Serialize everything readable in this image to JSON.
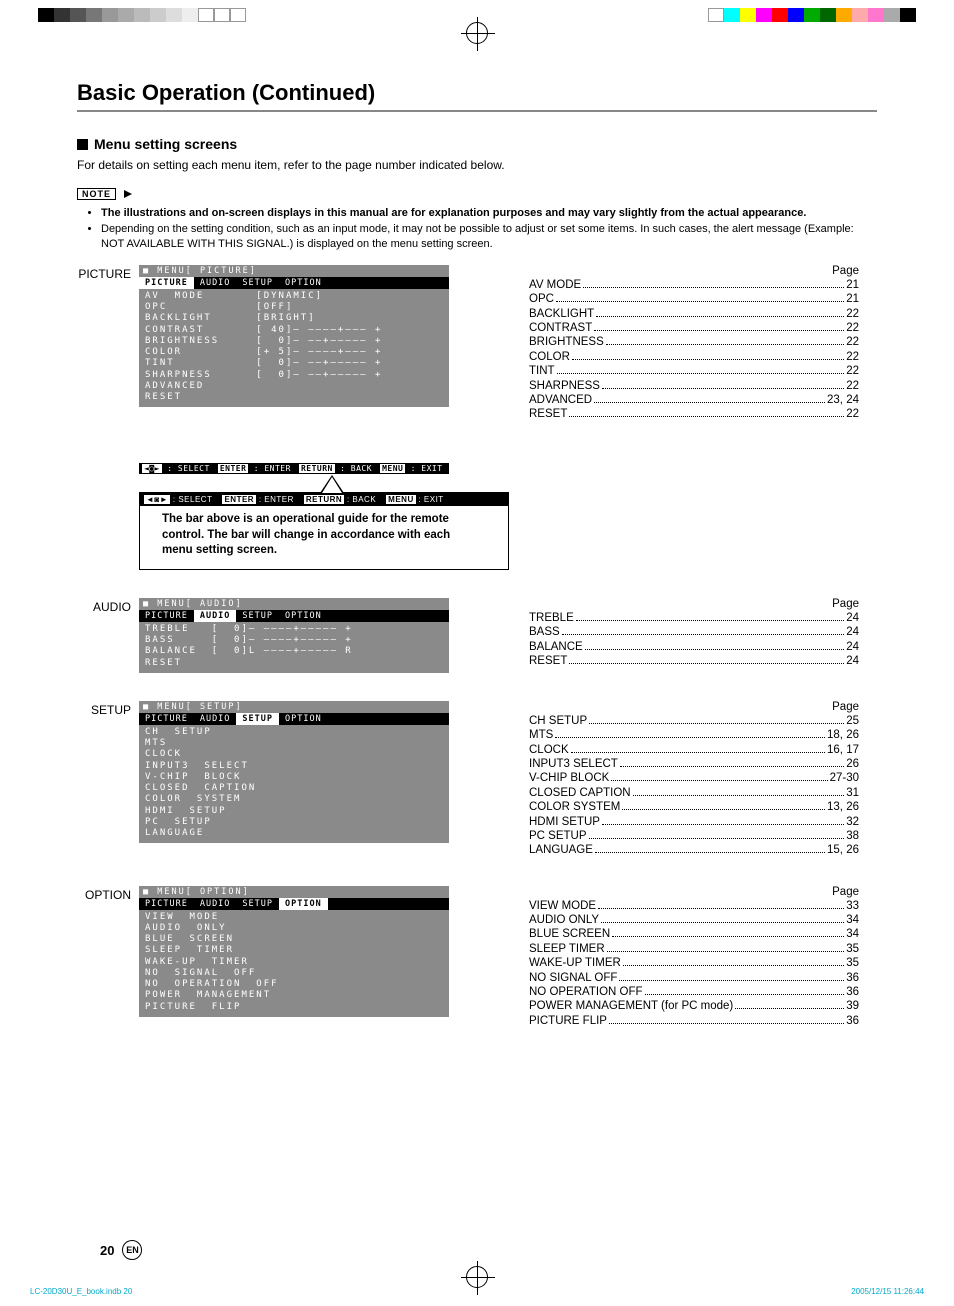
{
  "header": {
    "title": "Basic Operation (Continued)"
  },
  "subhead": "Menu setting screens",
  "intro": "For details on setting each menu item, refer to the page number indicated below.",
  "note_label": "NOTE",
  "notes": [
    {
      "bold": true,
      "text": "The illustrations and on-screen displays in this manual are for explanation purposes and may vary slightly from the actual appearance."
    },
    {
      "bold": false,
      "text": "Depending on the setting condition, such as an input mode, it may not be possible to adjust or set some items. In such cases, the alert message (Example: NOT AVAILABLE WITH THIS SIGNAL.) is displayed on the menu setting screen."
    }
  ],
  "page_header": "Page",
  "osd_footer": {
    "select": ": SELECT",
    "enter_key": "ENTER",
    "enter": ": ENTER",
    "return_key": "RETURN",
    "return": ": BACK",
    "menu_key": "MENU",
    "menu": ": EXIT"
  },
  "callout_text": "The bar above is an operational guide for the remote control. The bar will change in accordance with each menu setting screen.",
  "sections": [
    {
      "label": "PICTURE",
      "osd": {
        "title": "MENU[   PICTURE]",
        "tabs": [
          "PICTURE",
          "AUDIO",
          "SETUP",
          "OPTION"
        ],
        "active_tab": 0,
        "rows": [
          "AV  MODE       [DYNAMIC]",
          "OPC            [OFF]",
          "BACKLIGHT      [BRIGHT]",
          "CONTRAST       [ 40]– ––––+––– +",
          "BRIGHTNESS     [  0]– ––+––––– +",
          "COLOR          [+ 5]– ––––+––– +",
          "TINT           [  0]– ––+––––– +",
          "SHARPNESS      [  0]– ––+––––– +",
          "ADVANCED",
          "RESET"
        ],
        "has_footer": true,
        "has_callout": true
      },
      "index": [
        {
          "label": "AV MODE",
          "page": "21"
        },
        {
          "label": "OPC",
          "page": "21"
        },
        {
          "label": "BACKLIGHT",
          "page": "22"
        },
        {
          "label": "CONTRAST",
          "page": "22"
        },
        {
          "label": "BRIGHTNESS",
          "page": "22"
        },
        {
          "label": "COLOR",
          "page": "22"
        },
        {
          "label": "TINT",
          "page": "22"
        },
        {
          "label": "SHARPNESS",
          "page": "22"
        },
        {
          "label": "ADVANCED",
          "page": "23, 24"
        },
        {
          "label": "RESET",
          "page": "22"
        }
      ]
    },
    {
      "label": "AUDIO",
      "osd": {
        "title": "MENU[   AUDIO]",
        "tabs": [
          "PICTURE",
          "AUDIO",
          "SETUP",
          "OPTION"
        ],
        "active_tab": 1,
        "rows": [
          "TREBLE   [  0]– ––––+––––– +",
          "BASS     [  0]– ––––+––––– +",
          "BALANCE  [  0]L ––––+––––– R",
          "RESET"
        ],
        "has_footer": false,
        "has_callout": false
      },
      "index": [
        {
          "label": "TREBLE",
          "page": "24"
        },
        {
          "label": "BASS",
          "page": "24"
        },
        {
          "label": "BALANCE",
          "page": "24"
        },
        {
          "label": "RESET",
          "page": "24"
        }
      ]
    },
    {
      "label": "SETUP",
      "osd": {
        "title": "MENU[   SETUP]",
        "tabs": [
          "PICTURE",
          "AUDIO",
          "SETUP",
          "OPTION"
        ],
        "active_tab": 2,
        "rows": [
          "CH  SETUP",
          "MTS",
          "CLOCK",
          "INPUT3  SELECT",
          "V-CHIP  BLOCK",
          "CLOSED  CAPTION",
          "COLOR  SYSTEM",
          "HDMI  SETUP",
          "PC  SETUP",
          "LANGUAGE"
        ],
        "has_footer": false,
        "has_callout": false
      },
      "index": [
        {
          "label": "CH SETUP",
          "page": "25"
        },
        {
          "label": "MTS",
          "page": "18, 26"
        },
        {
          "label": "CLOCK",
          "page": "16, 17"
        },
        {
          "label": "INPUT3 SELECT",
          "page": "26"
        },
        {
          "label": "V-CHIP BLOCK",
          "page": "27-30"
        },
        {
          "label": "CLOSED CAPTION",
          "page": "31"
        },
        {
          "label": "COLOR SYSTEM",
          "page": "13, 26"
        },
        {
          "label": "HDMI SETUP",
          "page": "32"
        },
        {
          "label": "PC SETUP",
          "page": "38"
        },
        {
          "label": "LANGUAGE",
          "page": "15, 26"
        }
      ]
    },
    {
      "label": "OPTION",
      "osd": {
        "title": "MENU[   OPTION]",
        "tabs": [
          "PICTURE",
          "AUDIO",
          "SETUP",
          "OPTION"
        ],
        "active_tab": 3,
        "rows": [
          "VIEW  MODE",
          "AUDIO  ONLY",
          "BLUE  SCREEN",
          "SLEEP  TIMER",
          "WAKE-UP  TIMER",
          "NO  SIGNAL  OFF",
          "NO  OPERATION  OFF",
          "POWER  MANAGEMENT",
          "PICTURE  FLIP"
        ],
        "has_footer": false,
        "has_callout": false
      },
      "index": [
        {
          "label": "VIEW MODE",
          "page": "33"
        },
        {
          "label": "AUDIO ONLY",
          "page": "34"
        },
        {
          "label": "BLUE SCREEN",
          "page": "34"
        },
        {
          "label": "SLEEP TIMER",
          "page": "35"
        },
        {
          "label": "WAKE-UP TIMER",
          "page": "35"
        },
        {
          "label": "NO SIGNAL OFF",
          "page": "36"
        },
        {
          "label": "NO OPERATION OFF",
          "page": "36"
        },
        {
          "label": "POWER MANAGEMENT (for PC mode)",
          "page": "39"
        },
        {
          "label": "PICTURE FLIP",
          "page": "36"
        }
      ]
    }
  ],
  "footer": {
    "page_num": "20",
    "lang": "EN"
  },
  "print_line": {
    "left": "LC-20D30U_E_book.indb   20",
    "right": "2005/12/15   11:26:44"
  },
  "reg_colors_left": [
    "#000",
    "#333",
    "#555",
    "#777",
    "#999",
    "#aaa",
    "#bbb",
    "#ccc",
    "#ddd",
    "#eee",
    "#fff",
    "#fff",
    "#fff"
  ],
  "reg_colors_right": [
    "#fff",
    "#0ff",
    "#ff0",
    "#f0f",
    "#f00",
    "#00f",
    "#0a0",
    "#060",
    "#fa0",
    "#faa",
    "#f7c",
    "#aaa",
    "#000"
  ]
}
